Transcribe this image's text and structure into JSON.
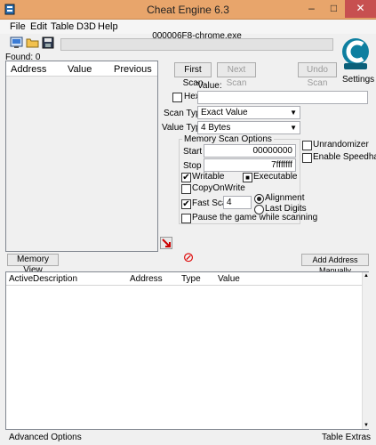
{
  "window": {
    "title": "Cheat Engine 6.3",
    "minimize": "–",
    "maximize": "□",
    "close": "✕"
  },
  "menu": [
    "File",
    "Edit",
    "Table",
    "D3D",
    "Help"
  ],
  "process": {
    "name": "000006F8-chrome.exe",
    "found": "Found: 0"
  },
  "settings_label": "Settings",
  "found_list": {
    "columns": [
      "Address",
      "Value",
      "Previous"
    ]
  },
  "scan": {
    "first_scan": "First Scan",
    "next_scan": "Next Scan",
    "undo_scan": "Undo Scan",
    "value_label": "Value:",
    "hex_label": "Hex",
    "value": "",
    "scan_type_label": "Scan Type",
    "scan_type": "Exact Value",
    "value_type_label": "Value Type",
    "value_type": "4 Bytes"
  },
  "memory_options": {
    "title": "Memory Scan Options",
    "start_label": "Start",
    "start": "00000000",
    "stop_label": "Stop",
    "stop": "7fffffff",
    "writable": "Writable",
    "writable_checked": "✔",
    "executable": "Executable",
    "executable_state": "■",
    "copyonwrite": "CopyOnWrite",
    "fast_scan": "Fast Scan",
    "fast_scan_checked": "✔",
    "fast_scan_value": "4",
    "alignment": "Alignment",
    "last_digits": "Last Digits",
    "pause": "Pause the game while scanning"
  },
  "extras": {
    "unrandomizer": "Unrandomizer",
    "enable_speedhack": "Enable Speedhack"
  },
  "buttons": {
    "memory_view": "Memory View",
    "add_address": "Add Address Manually",
    "stop_icon": "⊘"
  },
  "address_list": {
    "columns": [
      "Active",
      "Description",
      "Address",
      "Type",
      "Value"
    ]
  },
  "status": {
    "advanced": "Advanced Options",
    "table_extras": "Table Extras"
  }
}
